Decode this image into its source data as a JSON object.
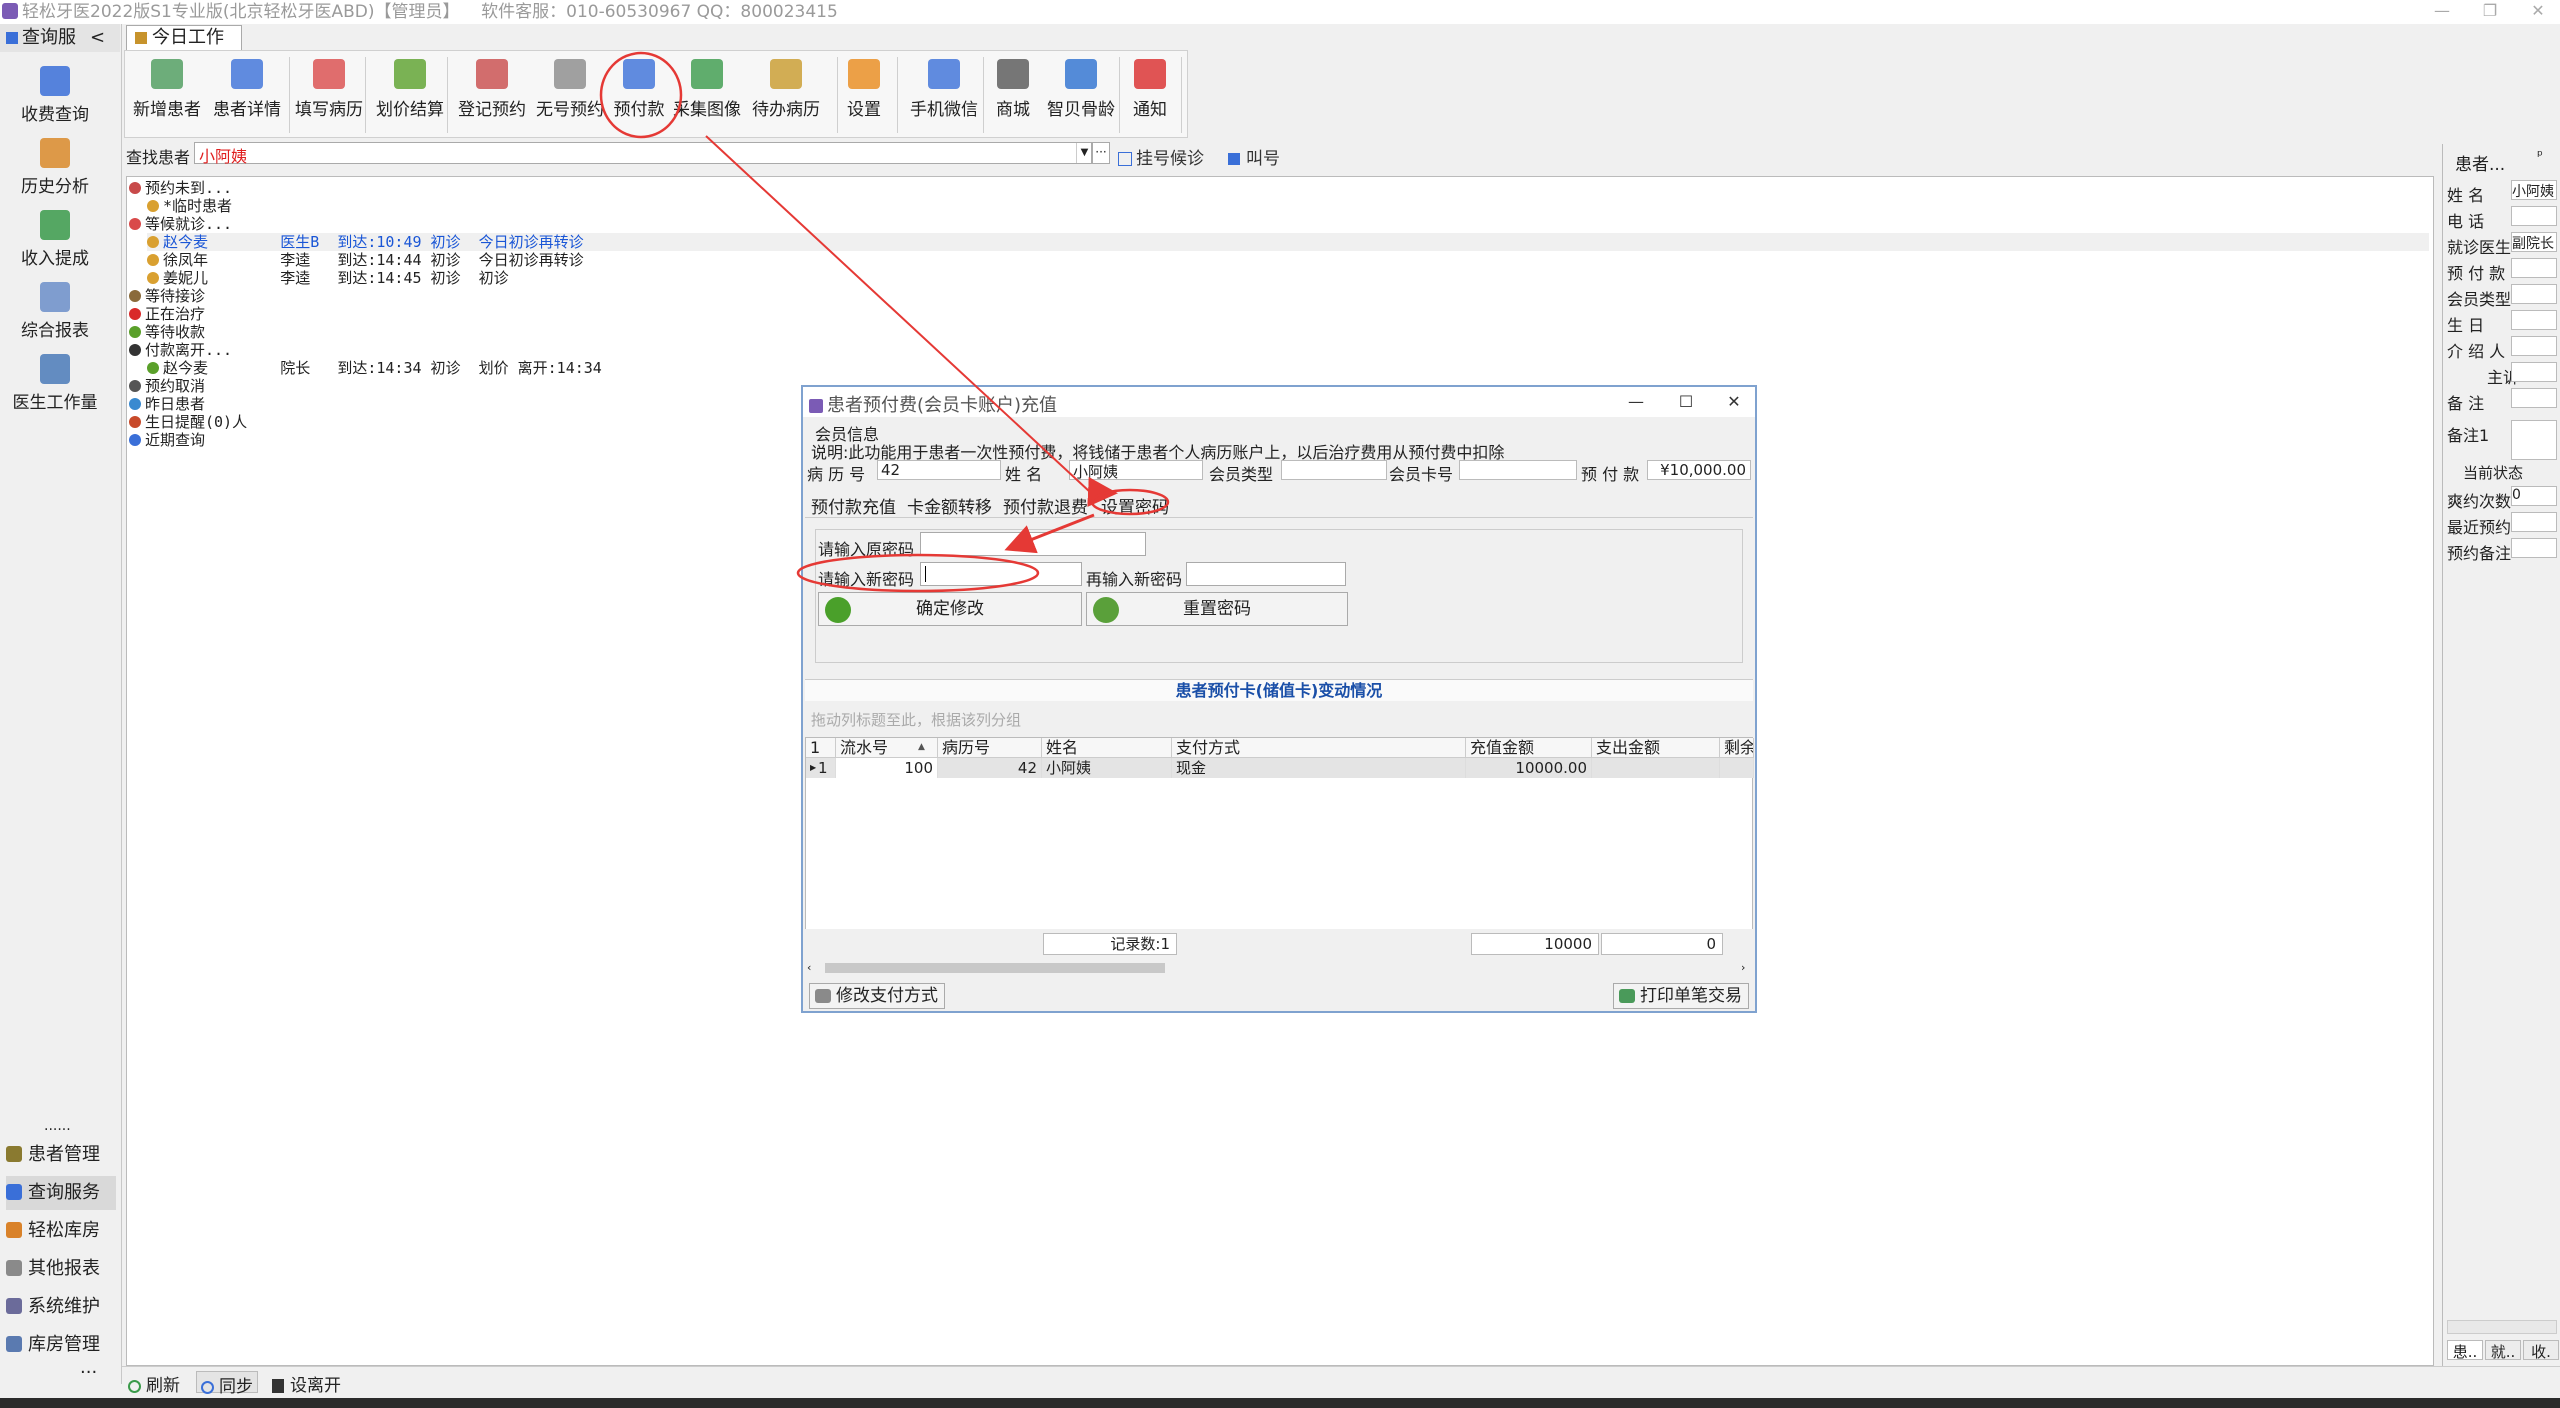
{
  "app": {
    "title": "轻松牙医2022版S1专业版(北京轻松牙医ABD)【管理员】",
    "service": "软件客服：010-60530967 QQ：800023415"
  },
  "sidebar": {
    "header": "查询服",
    "header_arrow": "<",
    "tools": [
      {
        "label": "收费查询",
        "icon": "bar-chart-icon",
        "color": "#3a6fd8"
      },
      {
        "label": "历史分析",
        "icon": "chart-book-icon",
        "color": "#d98a2a"
      },
      {
        "label": "收入提成",
        "icon": "stack-chart-icon",
        "color": "#3a9a4a"
      },
      {
        "label": "综合报表",
        "icon": "dots-icon",
        "color": "#6b8ec9"
      },
      {
        "label": "医生工作量",
        "icon": "doctor-icon",
        "color": "#4a7ab8"
      }
    ],
    "more_dots": "......",
    "nav": [
      {
        "label": "患者管理",
        "icon": "patients-icon",
        "color": "#8a7a30"
      },
      {
        "label": "查询服务",
        "icon": "query-icon",
        "color": "#3a6fd8"
      },
      {
        "label": "轻松库房",
        "icon": "warehouse-icon",
        "color": "#d9822a"
      },
      {
        "label": "其他报表",
        "icon": "report-icon",
        "color": "#8a8a8a"
      },
      {
        "label": "系统维护",
        "icon": "gear-icon",
        "color": "#6b6b9a"
      },
      {
        "label": "库房管理",
        "icon": "storage-icon",
        "color": "#5a7ab0"
      }
    ],
    "more": "···"
  },
  "tab": {
    "label": "今日工作"
  },
  "toolbar": [
    {
      "label": "新增患者",
      "icon": "add-patient-icon",
      "color": "#4a9a5a"
    },
    {
      "label": "患者详情",
      "icon": "patient-detail-icon",
      "color": "#3a6fd8"
    },
    {
      "label": "填写病历",
      "icon": "medical-record-icon",
      "color": "#d94a4a"
    },
    {
      "label": "划价结算",
      "icon": "yen-icon",
      "color": "#5aa02a"
    },
    {
      "label": "登记预约",
      "icon": "calendar-icon",
      "color": "#c84a4a"
    },
    {
      "label": "无号预约",
      "icon": "calendar-grid-icon",
      "color": "#8a8a8a"
    },
    {
      "label": "预付款",
      "icon": "prepay-icon",
      "color": "#3a6fd8"
    },
    {
      "label": "采集图像",
      "icon": "image-icon",
      "color": "#3a9a4a"
    },
    {
      "label": "待办病历",
      "icon": "todo-record-icon",
      "color": "#c89a2a"
    },
    {
      "label": "设置",
      "icon": "rss-settings-icon",
      "color": "#e88a1a"
    },
    {
      "label": "手机微信",
      "icon": "phone-icon",
      "color": "#3a6fd8"
    },
    {
      "label": "商城",
      "icon": "cart-icon",
      "color": "#555555"
    },
    {
      "label": "智贝骨龄",
      "icon": "bone-age-icon",
      "color": "#2a6fd0"
    },
    {
      "label": "通知",
      "icon": "alert-icon",
      "color": "#d92a2a"
    }
  ],
  "search": {
    "label": "查找患者",
    "value": "小阿姨",
    "more": "···",
    "queue_btn": "挂号候诊",
    "call_btn": "叫号"
  },
  "tree": {
    "rows": [
      {
        "text": "预约未到...",
        "indent": 0,
        "icon_color": "#c84a4a",
        "sel": false
      },
      {
        "text": "*临时患者",
        "indent": 1,
        "icon_color": "#d9a030",
        "sel": false
      },
      {
        "text": "等候就诊...",
        "indent": 0,
        "icon_color": "#d94a4a",
        "sel": false
      },
      {
        "text": "赵今麦        医生B  到达:10:49 初诊  今日初诊再转诊",
        "indent": 1,
        "icon_color": "#d9a030",
        "sel": true,
        "blue": true
      },
      {
        "text": "徐凤年        李逵   到达:14:44 初诊  今日初诊再转诊",
        "indent": 1,
        "icon_color": "#d9a030",
        "sel": false
      },
      {
        "text": "姜妮儿        李逵   到达:14:45 初诊  初诊",
        "indent": 1,
        "icon_color": "#d9a030",
        "sel": false
      },
      {
        "text": "等待接诊",
        "indent": 0,
        "icon_color": "#8a6a3a",
        "sel": false
      },
      {
        "text": "正在治疗",
        "indent": 0,
        "icon_color": "#d92a2a",
        "sel": false
      },
      {
        "text": "等待收款",
        "indent": 0,
        "icon_color": "#5aa02a",
        "sel": false
      },
      {
        "text": "付款离开...",
        "indent": 0,
        "icon_color": "#333333",
        "sel": false
      },
      {
        "text": "赵今麦        院长   到达:14:34 初诊  划价 离开:14:34",
        "indent": 1,
        "icon_color": "#5aa02a",
        "sel": false
      },
      {
        "text": "预约取消",
        "indent": 0,
        "icon_color": "#555555",
        "sel": false
      },
      {
        "text": "昨日患者",
        "indent": 0,
        "icon_color": "#3a8ad0",
        "sel": false
      },
      {
        "text": "生日提醒(0)人",
        "indent": 0,
        "icon_color": "#c84a2a",
        "sel": false
      },
      {
        "text": "近期查询",
        "indent": 0,
        "icon_color": "#3a6fd8",
        "sel": false
      }
    ]
  },
  "right_panel": {
    "title": "患者...",
    "pin": "ᵖ",
    "fields": [
      {
        "label": "姓    名",
        "value": "小阿姨"
      },
      {
        "label": "电    话",
        "value": ""
      },
      {
        "label": "就诊医生",
        "value": "副院长"
      },
      {
        "label": "预 付 款",
        "value": ""
      },
      {
        "label": "会员类型",
        "value": ""
      },
      {
        "label": "生    日",
        "value": ""
      },
      {
        "label": "介 绍 人",
        "value": ""
      },
      {
        "label": "主诉",
        "value": ""
      },
      {
        "label": "备    注",
        "value": ""
      },
      {
        "label": "备注1",
        "value": ""
      }
    ],
    "status_title": "当前状态",
    "status_fields": [
      {
        "label": "爽约次数",
        "value": "0"
      },
      {
        "label": "最近预约",
        "value": ""
      },
      {
        "label": "预约备注",
        "value": ""
      }
    ],
    "tabs": [
      "患..",
      "就..",
      "收."
    ]
  },
  "bottom": {
    "refresh": "刷新",
    "sync": "同步",
    "leave": "设离开"
  },
  "dialog": {
    "title": "患者预付费(会员卡账户)充值",
    "group": "会员信息",
    "desc": "说明:此功能用于患者一次性预付费，将钱储于患者个人病历账户上，以后治疗费用从预付费中扣除",
    "info": {
      "record_label": "病 历 号",
      "record": "42",
      "name_label": "姓    名",
      "name": "小阿姨",
      "type_label": "会员类型",
      "type": "",
      "card_label": "会员卡号",
      "card": "",
      "prepay_label": "预 付 款",
      "prepay": "¥10,000.00"
    },
    "tabs": [
      "预付款充值",
      "卡金额转移",
      "预付款退费",
      "设置密码"
    ],
    "pw": {
      "old_label": "请输入原密码",
      "new_label": "请输入新密码",
      "again_label": "再输入新密码",
      "confirm": "确定修改",
      "reset": "重置密码"
    },
    "grid_title": "患者预付卡(储值卡)变动情况",
    "group_hint": "拖动列标题至此，根据该列分组",
    "columns": [
      "1",
      "流水号",
      "病历号",
      "姓名",
      "支付方式",
      "充值金额",
      "支出金额",
      "剩余"
    ],
    "rows": [
      {
        "idx": "1",
        "serial": "100",
        "record": "42",
        "name": "小阿姨",
        "pay": "现金",
        "charge": "10000.00",
        "spend": "",
        "rest": ""
      }
    ],
    "footer": {
      "count": "记录数:1",
      "charge_total": "10000",
      "spend_total": "0"
    },
    "btn_pay": "修改支付方式",
    "btn_print": "打印单笔交易"
  },
  "colors": {
    "annotation": "#e53935",
    "dialog_border": "#7fa2cf",
    "grid_title": "#1a4fa8"
  }
}
